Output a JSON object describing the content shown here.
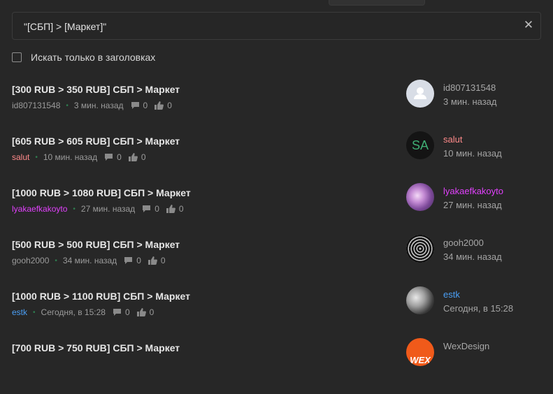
{
  "search": {
    "query": "\"[СБП] > [Маркет]\"",
    "clear_icon": "close-icon"
  },
  "filter": {
    "titles_only_label": "Искать только в заголовках",
    "checked": false
  },
  "results": [
    {
      "title": "[300 RUB > 350 RUB] СБП > Маркет",
      "author": "id807131548",
      "author_color": "#9b9b9b",
      "time": "3 мин. назад",
      "replies": "0",
      "likes": "0",
      "side_name": "id807131548",
      "side_time": "3 мин. назад",
      "avatar": "default-user-avatar"
    },
    {
      "title": "[605 RUB > 605 RUB] СБП > Маркет",
      "author": "salut",
      "author_color": "#ff8a8a",
      "time": "10 мин. назад",
      "replies": "0",
      "likes": "0",
      "side_name": "salut",
      "side_time": "10 мин. назад",
      "avatar": "initials-avatar",
      "avatar_initials": "SA"
    },
    {
      "title": "[1000 RUB > 1080 RUB] СБП > Маркет",
      "author": "lyakaefkakoyto",
      "author_color": "#e040fb",
      "time": "27 мин. назад",
      "replies": "0",
      "likes": "0",
      "side_name": "lyakaefkakoyto",
      "side_time": "27 мин. назад",
      "avatar": "photo-avatar-purple"
    },
    {
      "title": "[500 RUB > 500 RUB] СБП > Маркет",
      "author": "gooh2000",
      "author_color": "#9b9b9b",
      "time": "34 мин. назад",
      "replies": "0",
      "likes": "0",
      "side_name": "gooh2000",
      "side_time": "34 мин. назад",
      "avatar": "pattern-avatar"
    },
    {
      "title": "[1000 RUB > 1100 RUB] СБП > Маркет",
      "author": "estk",
      "author_color": "#4a9ff5",
      "time": "Сегодня, в 15:28",
      "replies": "0",
      "likes": "0",
      "side_name": "estk",
      "side_time": "Сегодня, в 15:28",
      "avatar": "photo-avatar-gray"
    },
    {
      "title": "[700 RUB > 750 RUB] СБП > Маркет",
      "author": "",
      "author_color": "#9b9b9b",
      "time": "",
      "replies": "",
      "likes": "",
      "side_name": "WexDesign",
      "side_time": "",
      "avatar": "logo-avatar",
      "avatar_initials": "WEX"
    }
  ],
  "icons": {
    "reply": "comment-icon",
    "like": "thumbs-up-icon"
  }
}
